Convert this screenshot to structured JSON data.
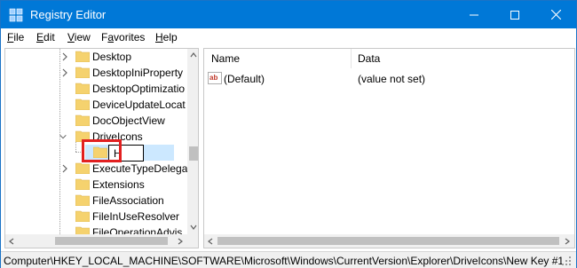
{
  "window": {
    "title": "Registry Editor"
  },
  "menu": {
    "items": [
      "File",
      "Edit",
      "View",
      "Favorites",
      "Help"
    ],
    "mnemonics": [
      "F",
      "E",
      "V",
      "a",
      "H"
    ]
  },
  "tree": {
    "items": [
      {
        "label": "Desktop",
        "expandable": true,
        "expanded": false
      },
      {
        "label": "DesktopIniProperty",
        "expandable": true,
        "expanded": false
      },
      {
        "label": "DesktopOptimizatio",
        "expandable": false,
        "expanded": false
      },
      {
        "label": "DeviceUpdateLocat",
        "expandable": false,
        "expanded": false
      },
      {
        "label": "DocObjectView",
        "expandable": false,
        "expanded": false
      },
      {
        "label": "DriveIcons",
        "expandable": true,
        "expanded": true
      }
    ],
    "rename_value": "H",
    "items_after": [
      {
        "label": "ExecuteTypeDelega",
        "expandable": true,
        "expanded": false
      },
      {
        "label": "Extensions",
        "expandable": false,
        "expanded": false
      },
      {
        "label": "FileAssociation",
        "expandable": false,
        "expanded": false
      },
      {
        "label": "FileInUseResolver",
        "expandable": false,
        "expanded": false
      },
      {
        "label": "FileOperationAdvis",
        "expandable": false,
        "expanded": false
      }
    ]
  },
  "list": {
    "columns": {
      "name": "Name",
      "data": "Data"
    },
    "rows": [
      {
        "name": "(Default)",
        "data": "(value not set)",
        "icon": "string-value-icon"
      }
    ]
  },
  "status": {
    "path": "Computer\\HKEY_LOCAL_MACHINE\\SOFTWARE\\Microsoft\\Windows\\CurrentVersion\\Explorer\\DriveIcons\\New Key #1"
  },
  "colors": {
    "titlebar": "#0078d7",
    "selection": "#cce8ff",
    "highlight": "#e22020",
    "folder": "#f5d26e"
  }
}
